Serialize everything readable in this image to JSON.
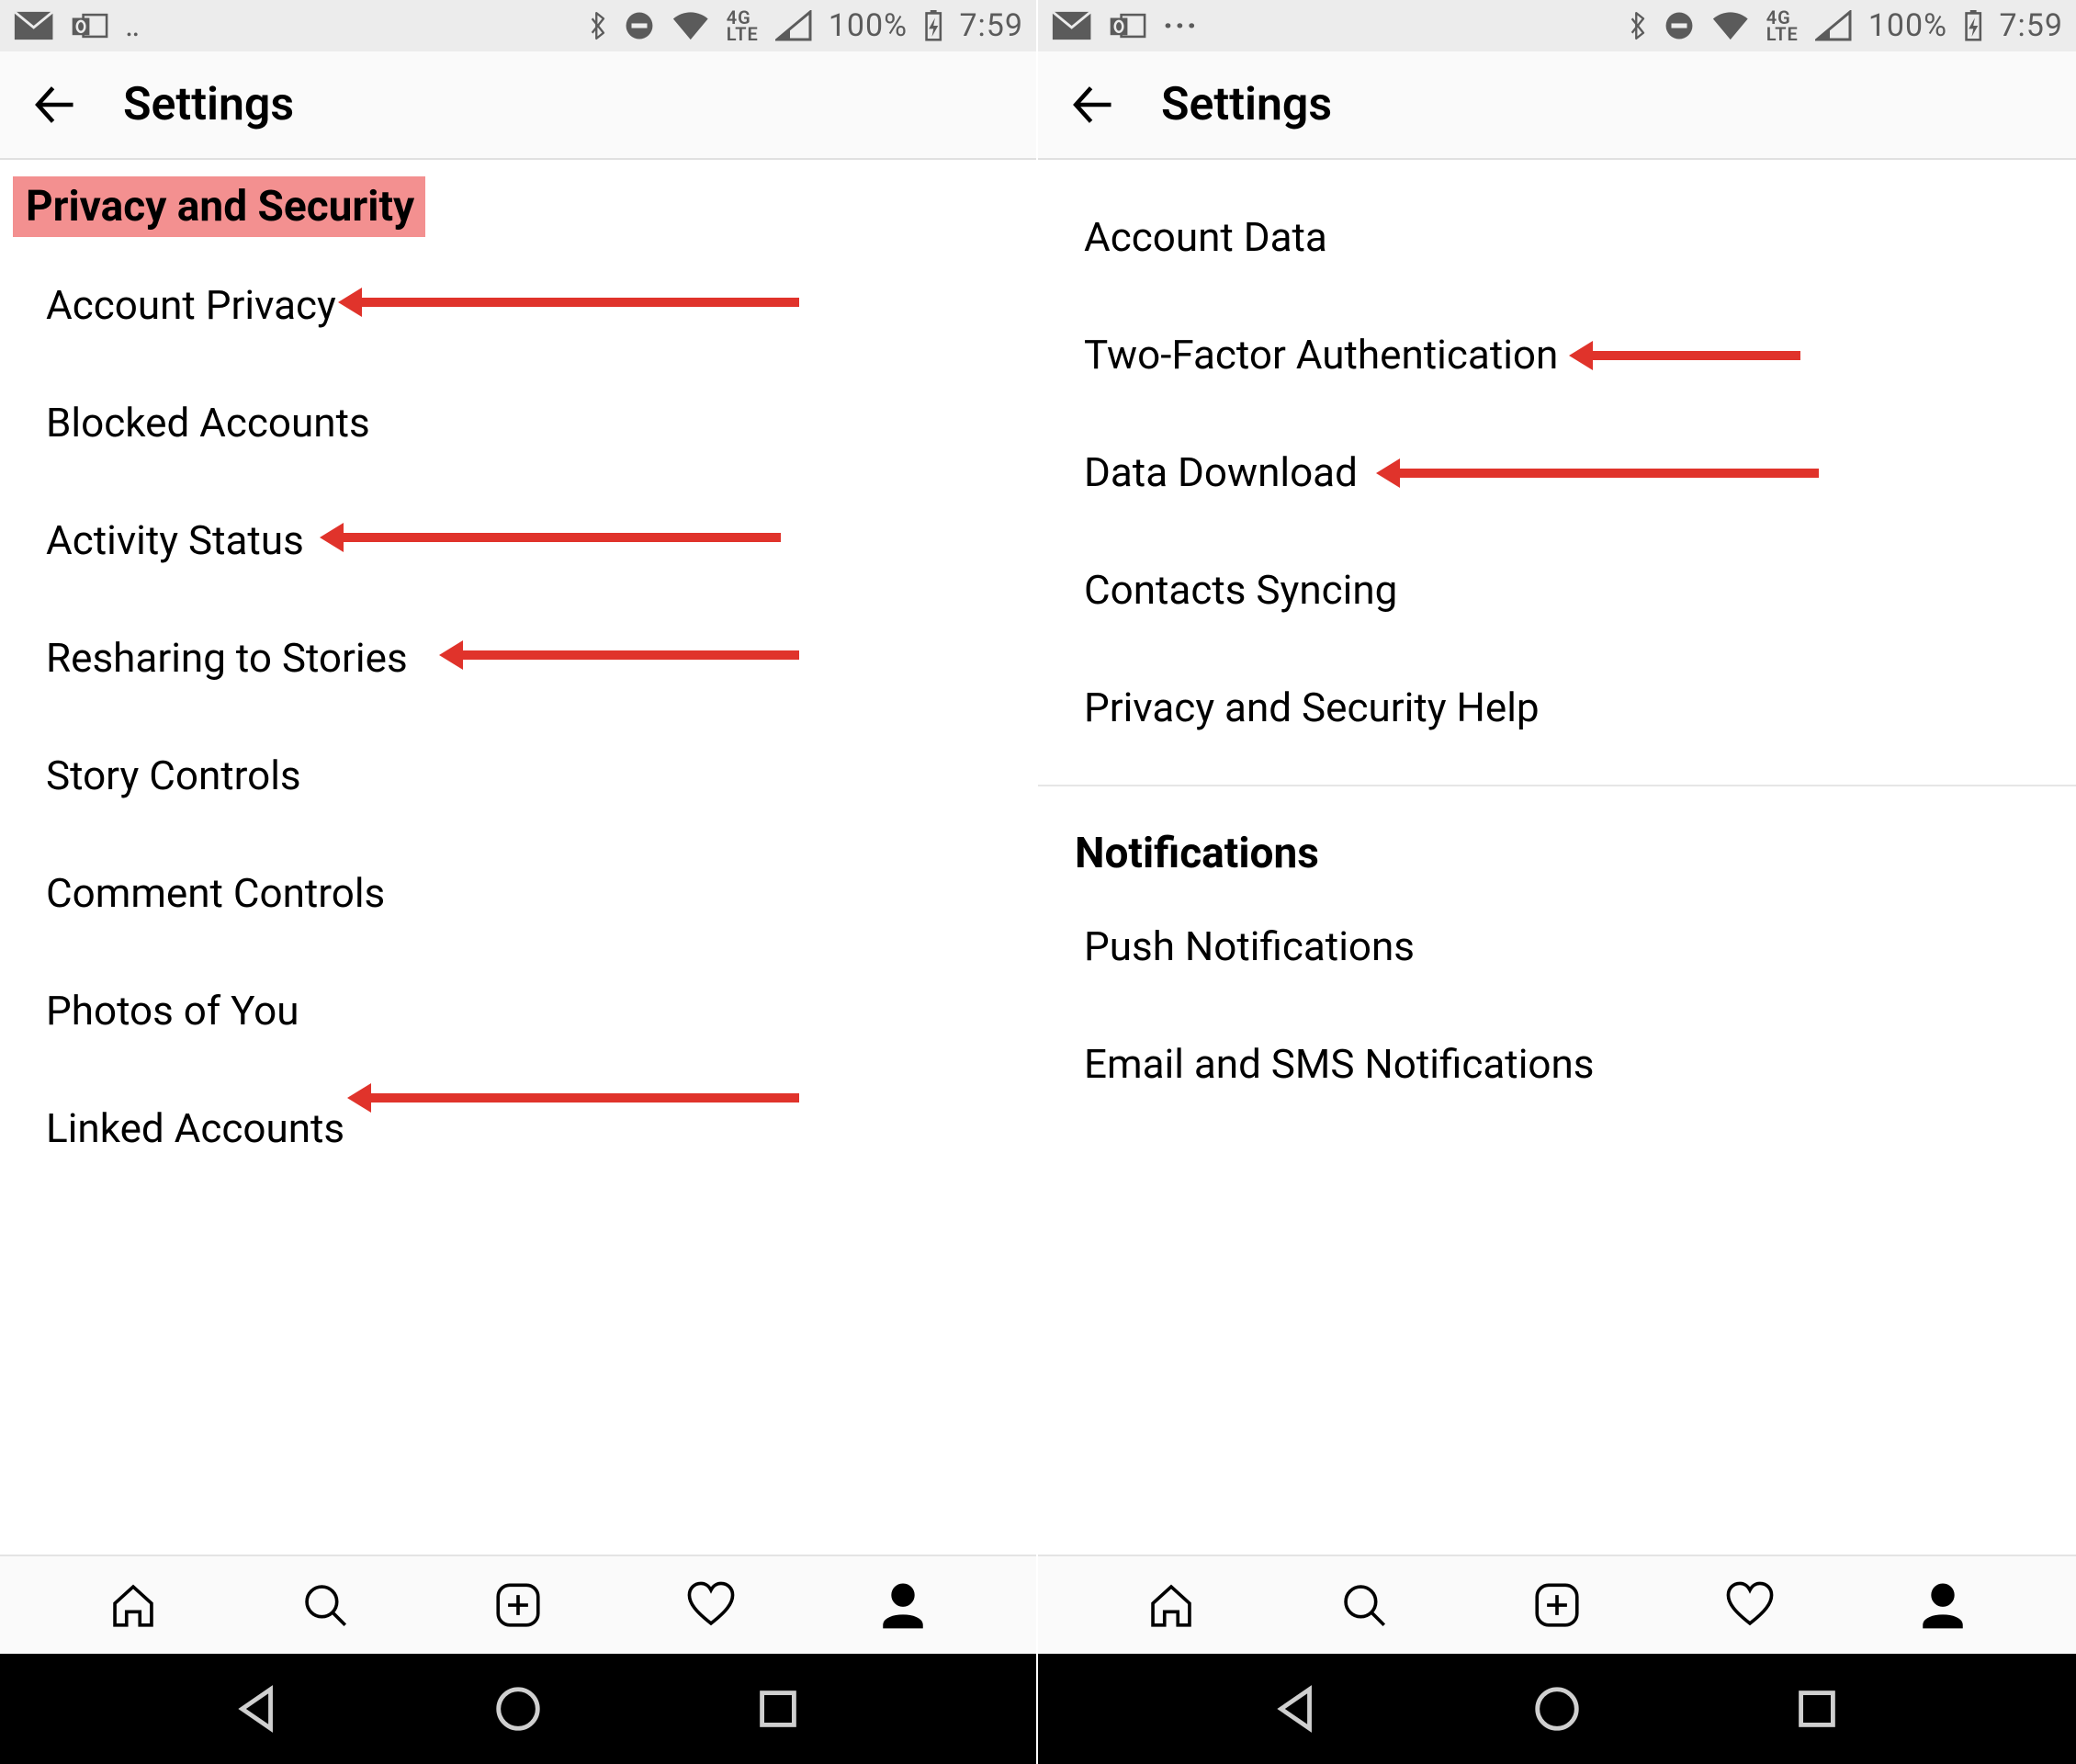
{
  "statusbar": {
    "network_label": "4G LTE",
    "battery_text": "100%",
    "clock": "7:59"
  },
  "header": {
    "title": "Settings"
  },
  "left": {
    "section_header": "Privacy and Security",
    "items": [
      {
        "label": "Account Privacy",
        "arrow": true
      },
      {
        "label": "Blocked Accounts",
        "arrow": false
      },
      {
        "label": "Activity Status",
        "arrow": true
      },
      {
        "label": "Resharing to Stories",
        "arrow": true
      },
      {
        "label": "Story Controls",
        "arrow": false
      },
      {
        "label": "Comment Controls",
        "arrow": false
      },
      {
        "label": "Photos of You",
        "arrow": false
      },
      {
        "label": "Linked Accounts",
        "arrow": true
      }
    ]
  },
  "right": {
    "groups": [
      {
        "header": null,
        "items": [
          {
            "label": "Account Data",
            "arrow": false
          },
          {
            "label": "Two-Factor Authentication",
            "arrow": true
          },
          {
            "label": "Data Download",
            "arrow": true
          },
          {
            "label": "Contacts Syncing",
            "arrow": false
          },
          {
            "label": "Privacy and Security Help",
            "arrow": false
          }
        ]
      },
      {
        "header": "Notifications",
        "items": [
          {
            "label": "Push Notifications",
            "arrow": false
          },
          {
            "label": "Email and SMS Notifications",
            "arrow": false
          }
        ]
      }
    ]
  },
  "annotation": {
    "arrow_color": "#e0332b"
  }
}
